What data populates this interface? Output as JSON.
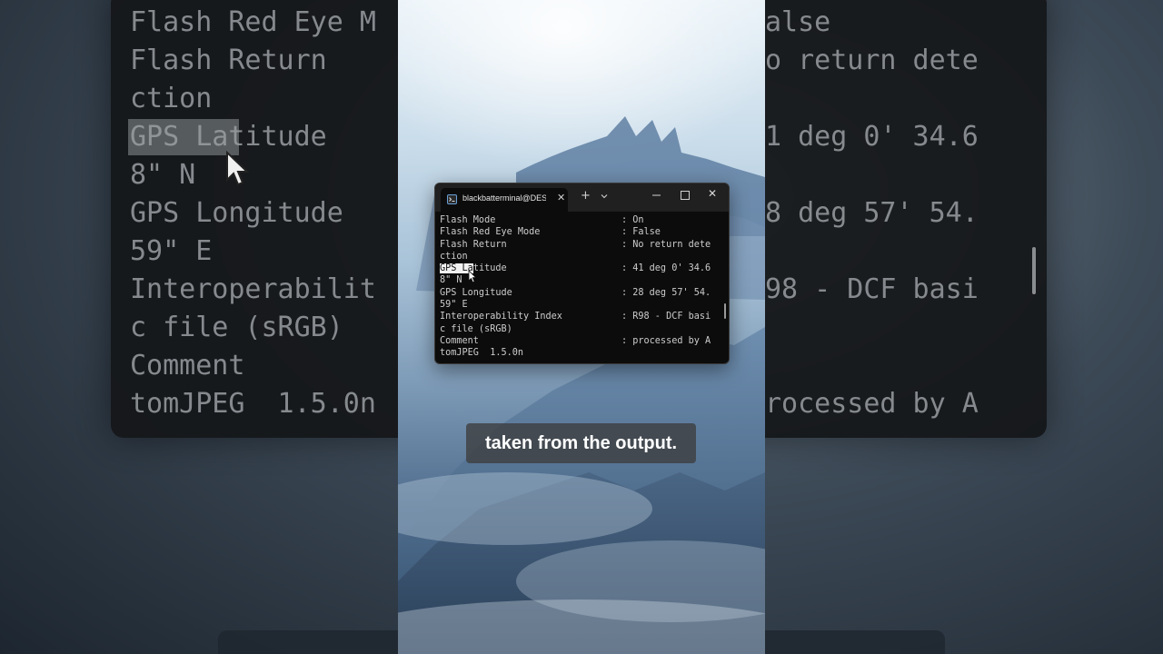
{
  "terminal": {
    "tab_title": "blackbatterminal@DESKT",
    "tab_close": "✕",
    "new_tab": "+",
    "window_close": "✕",
    "lines": [
      {
        "label": "Flash Mode",
        "value": ": On"
      },
      {
        "label": "Flash Red Eye Mode",
        "value": ": False"
      },
      {
        "label": "Flash Return",
        "value": ": No return dete"
      },
      {
        "label": "ction",
        "value": ""
      },
      {
        "label_selected": "GPS La",
        "label_rest": "titude",
        "value": ": 41 deg 0' 34.6"
      },
      {
        "label": "8\" N",
        "value": ""
      },
      {
        "label": "GPS Longitude",
        "value": ": 28 deg 57' 54."
      },
      {
        "label": "59\" E",
        "value": ""
      },
      {
        "label": "Interoperability Index",
        "value": ": R98 - DCF basi"
      },
      {
        "label": "c file (sRGB)",
        "value": ""
      },
      {
        "label": "Comment",
        "value": ": processed by A"
      },
      {
        "label": "tomJPEG  1.5.0n",
        "value": ""
      }
    ]
  },
  "backdrop": {
    "left_text": "Flash Red Eye M\nFlash Return\nction\nGPS Latitude\n8\" N\nGPS Longitude\n59\" E\nInteroperabilit\nc file (sRGB)\nComment\ntomJPEG  1.5.0n",
    "right_text": "alse\no return dete\n\n1 deg 0' 34.6\n\n8 deg 57' 54.\n\n98 - DCF basi\n\n\nrocessed by A"
  },
  "caption": {
    "text": "taken from the output."
  },
  "colors": {
    "terminal_bg": "#0c0c0c",
    "titlebar_bg": "#202020",
    "terminal_text": "#cccccc",
    "selection_bg": "#f2f2f2"
  }
}
